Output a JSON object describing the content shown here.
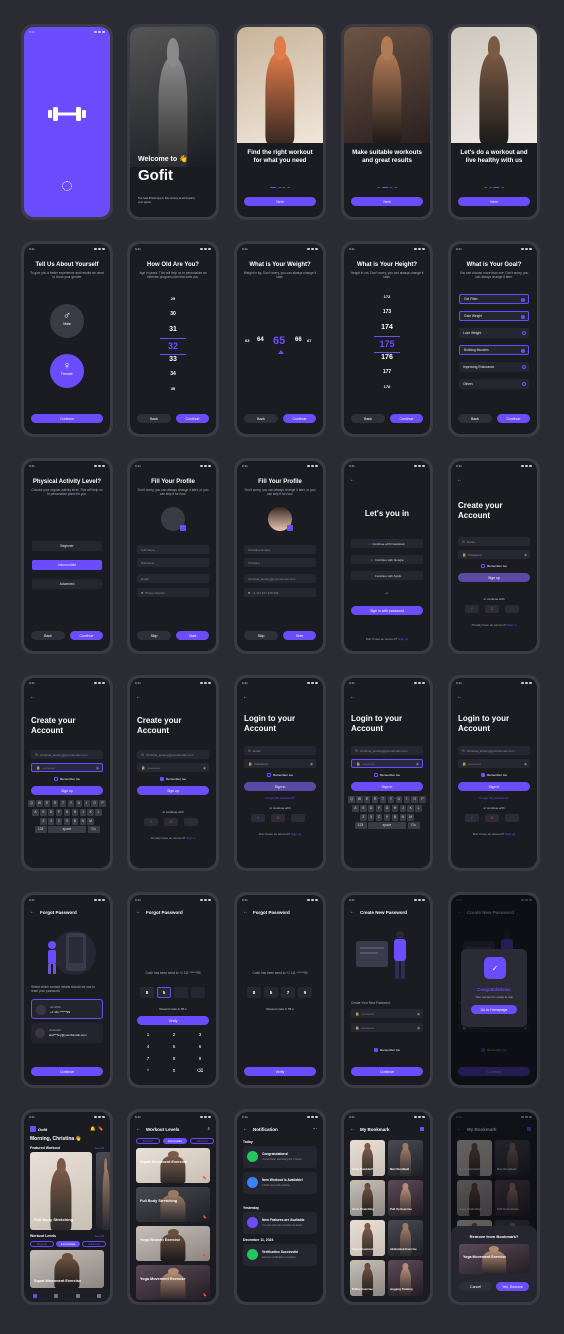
{
  "brand": {
    "accent": "#6b4dff",
    "bg": "#2a2b33",
    "screen": "#1b1c22"
  },
  "status_time": "9:41",
  "onboarding": {
    "welcome_title": "Welcome to",
    "welcome_emoji": "👋",
    "app_name": "Gofit",
    "welcome_sub": "The best fitness app in this century to accompany your sports.",
    "slides": [
      {
        "title": "Find the right workout for what you need",
        "button": "Next"
      },
      {
        "title": "Make suitable workouts and great results",
        "button": "Next"
      },
      {
        "title": "Let's do a workout and live healthy with us",
        "button": "Next"
      }
    ]
  },
  "setup": {
    "gender_title": "Tell Us About Yourself",
    "gender_sub": "To give you a better experience and results we need to know your gender",
    "male": "Male",
    "female": "Female",
    "age_title": "How Old Are You?",
    "age_sub": "Age in years. This will help us to personalize an exercise program plan that suits you.",
    "ages": [
      "29",
      "30",
      "31",
      "32",
      "33",
      "34",
      "35"
    ],
    "weight_title": "What is Your Weight?",
    "weight_sub": "Weight in kg. Don't worry, you can always change it later.",
    "weights": [
      "63",
      "64",
      "65",
      "66",
      "67"
    ],
    "height_title": "What is Your Height?",
    "height_sub": "Height in cm. Don't worry, you can always change it later.",
    "heights": [
      "172",
      "173",
      "174",
      "175",
      "176",
      "177",
      "178"
    ],
    "goal_title": "What is Your Goal?",
    "goal_sub": "You can choose more than one. Don't worry, you can always change it later.",
    "goals": [
      "Get Fitter",
      "Gain Weight",
      "Lose Weight",
      "Building Muscles",
      "Improving Endurance",
      "Others"
    ],
    "activity_title": "Physical Activity Level?",
    "activity_sub": "Choose your regular activity level. This will help us to personalize plans for you.",
    "levels": [
      "Beginner",
      "Intermediate",
      "Advanced"
    ],
    "back": "Back",
    "continue": "Continue"
  },
  "profile": {
    "title": "Fill Your Profile",
    "sub": "Don't worry, you can always change it later, or you can skip it for now.",
    "full_name": "Full Name",
    "nickname": "Nickname",
    "email": "Email",
    "phone": "Phone Number",
    "filled_name": "Christina Ainsley",
    "filled_nick": "Christina",
    "filled_email": "christina_ainsley@yourdomain.com",
    "filled_phone": "+1 111 467 378 399",
    "skip": "Skip",
    "start": "Start"
  },
  "auth": {
    "lets_in": "Let's you in",
    "facebook": "Continue with Facebook",
    "google": "Continue with Google",
    "apple": "Continue with Apple",
    "or": "or",
    "sign_in_password": "Sign in with password",
    "no_account": "Don't have an account?",
    "sign_up_link": "Sign up",
    "create_title": "Create your Account",
    "login_title": "Login to your Account",
    "email": "Email",
    "password": "Password",
    "remember": "Remember me",
    "sign_up": "Sign up",
    "sign_in": "Sign in",
    "forgot": "Forgot the password?",
    "or_continue": "or continue with",
    "have_account": "Already have an account?",
    "sign_in_link": "Sign in",
    "email_value": "christina_ainsley@yourdomain.com",
    "password_value": "••••••••••••"
  },
  "keyboard": {
    "row1": [
      "Q",
      "W",
      "E",
      "R",
      "T",
      "Y",
      "U",
      "I",
      "O",
      "P"
    ],
    "row2": [
      "A",
      "S",
      "D",
      "F",
      "G",
      "H",
      "J",
      "K",
      "L"
    ],
    "row3": [
      "Z",
      "X",
      "C",
      "V",
      "B",
      "N",
      "M"
    ],
    "num": "123",
    "space": "space",
    "go": "Go"
  },
  "recovery": {
    "forgot_title": "Forgot Password",
    "select_contact": "Select which contact details should we use to reset your password",
    "via_sms": "via SMS:",
    "sms_value": "+1 111 ******99",
    "via_email": "via Email:",
    "email_value": "and***ley@yourdomain.com",
    "continue": "Continue",
    "code_sent": "Code has been send to +1 111 ******99",
    "code_digits": [
      "8",
      "5",
      "",
      ""
    ],
    "code_digits_full": [
      "8",
      "5",
      "7",
      "9"
    ],
    "resend": "Resend code in 55 s",
    "verify": "Verify",
    "numpad": [
      "1",
      "2",
      "3",
      "4",
      "5",
      "6",
      "7",
      "8",
      "9",
      "*",
      "0",
      "⌫"
    ],
    "new_title": "Create New Password",
    "new_sub": "Create Your New Password",
    "remember": "Remember me",
    "congrats": "Congratulations!",
    "ready": "Your account is ready to use",
    "go_home": "Go to Homepage"
  },
  "home": {
    "brand": "Gofit",
    "greeting": "Morning, Christina",
    "featured": "Featured Workout",
    "see_all": "See All",
    "workout": "Full Body Stretching",
    "levels_title": "Workout Levels",
    "tabs": [
      "Beginner",
      "Intermediate",
      "Advanced"
    ],
    "level_cards": [
      "Squat Movement Exercise",
      "Full Body Stretching",
      "Yoga Women Exercise",
      "Yoga Movement Exercise"
    ],
    "home_card": "Squat Movement Exercise",
    "notif_title": "Notification",
    "today": "Today",
    "yesterday": "Yesterday",
    "dec": "December 11, 2024",
    "notifs": [
      {
        "title": "Congratulations!",
        "sub": "You've been exercising for 2 hours"
      },
      {
        "title": "New Workout is Available!",
        "sub": "Check new and practice"
      },
      {
        "title": "New Features are Available",
        "sub": "You can now set exercise reminder"
      },
      {
        "title": "Verification Successful",
        "sub": "Account verification complete"
      }
    ],
    "bookmark_title": "My Bookmark",
    "bookmarks": [
      "Arms Dumbbell",
      "Man Dumbbell",
      "Arms Stretching",
      "Pull Up Exercise",
      "Yoga Movement",
      "Abdominal Exercise",
      "Pullup Exercise",
      "Jogging Training"
    ],
    "remove_title": "Remove from Bookmark?",
    "remove_item": "Yoga Movement Exercise",
    "cancel": "Cancel",
    "yes_remove": "Yes, Remove"
  }
}
